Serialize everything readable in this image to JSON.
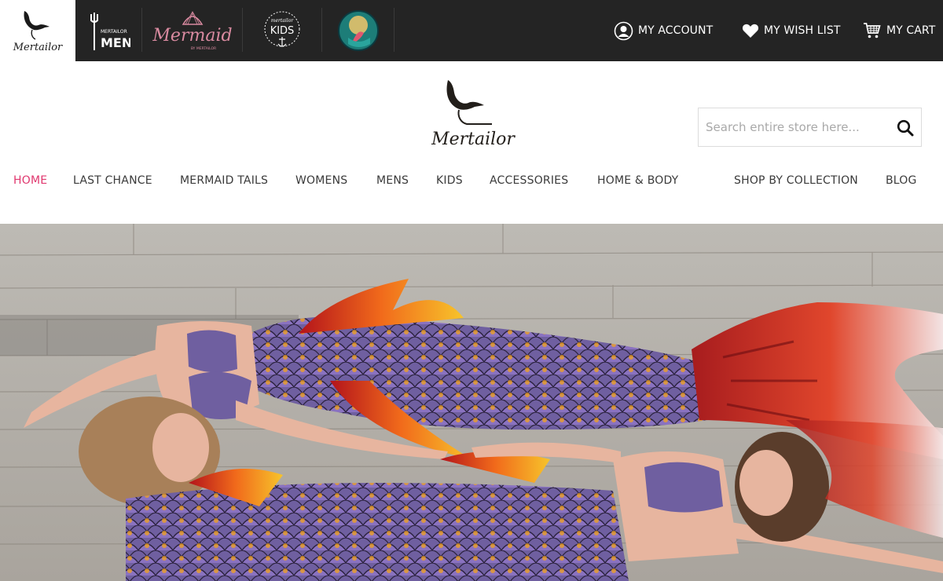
{
  "brand_tabs": [
    {
      "name": "Mertailor",
      "icon": "mertailor-whale-tail-logo",
      "active": true
    },
    {
      "name": "Mertailor Men",
      "icon": "mertailor-men-trident-logo",
      "active": false
    },
    {
      "name": "Mermaid by Mertailor",
      "icon": "mermaid-shell-logo",
      "active": false
    },
    {
      "name": "Mertailor Kids",
      "icon": "kids-anchor-logo",
      "active": false
    },
    {
      "name": "Mermaid circle",
      "icon": "mermaid-circle-logo",
      "active": false
    }
  ],
  "brand_text": {
    "men_small": "MERTAILOR",
    "men_big": "MEN",
    "mermaid_script": "Mermaid",
    "mermaid_sub": "BY MERTAILOR",
    "kids_small": "mertailor",
    "kids_big": "KIDS",
    "logo_script": "Mertailor"
  },
  "topnav": {
    "account": "MY ACCOUNT",
    "wishlist": "MY WISH LIST",
    "cart": "MY CART"
  },
  "search": {
    "placeholder": "Search entire store here..."
  },
  "mainnav": [
    {
      "label": "HOME",
      "active": true
    },
    {
      "label": "LAST CHANCE"
    },
    {
      "label": "MERMAID TAILS"
    },
    {
      "label": "WOMENS"
    },
    {
      "label": "MENS"
    },
    {
      "label": "KIDS"
    },
    {
      "label": "ACCESSORIES"
    },
    {
      "label": "HOME & BODY"
    },
    {
      "label": "SHOP BY COLLECTION"
    },
    {
      "label": "BLOG"
    }
  ],
  "colors": {
    "topbar": "#242424",
    "accent": "#e0386f",
    "nav_text": "#3a3a3a"
  },
  "hero": {
    "image": "hero-photo-two-mermaids-on-wood-floor"
  }
}
